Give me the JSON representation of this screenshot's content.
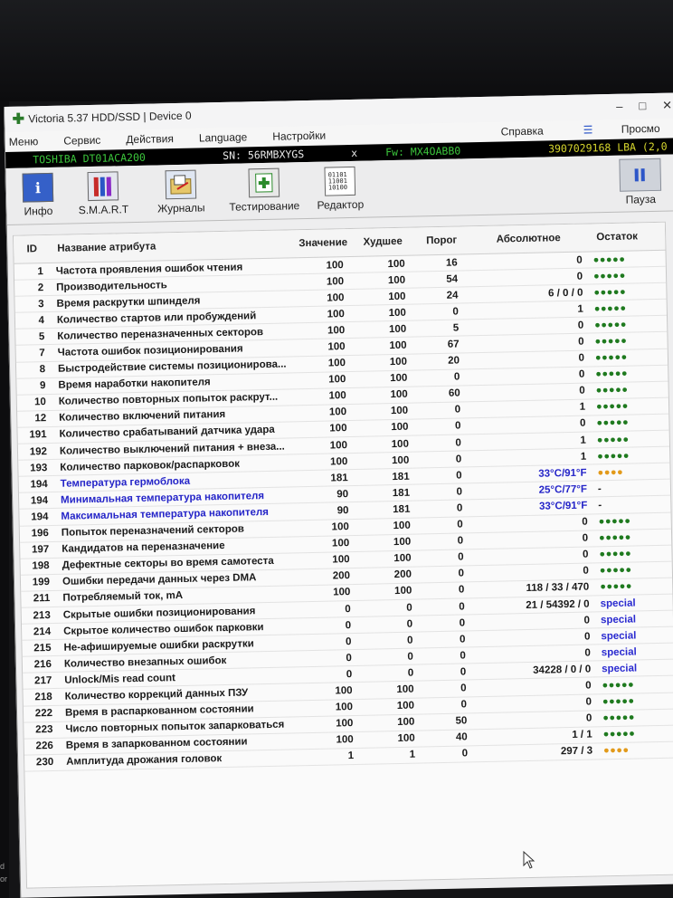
{
  "window": {
    "title": "Victoria 5.37 HDD/SSD | Device 0"
  },
  "menu": [
    "Меню",
    "Сервис",
    "Действия",
    "Language",
    "Настройки"
  ],
  "menu_right": {
    "help": "Справка",
    "view": "Просмо"
  },
  "device": {
    "model": "TOSHIBA DT01ACA200",
    "serial": "SN: 56RMBXYGS",
    "sep": "x",
    "firmware": "Fw: MX4OABB0",
    "lba": "3907029168 LBA (2,0 T"
  },
  "toolbar": {
    "info": "Инфо",
    "smart": "S.M.A.R.T",
    "logs": "Журналы",
    "test": "Тестирование",
    "editor": "Редактор",
    "pause": "Пауза"
  },
  "icon_names": [
    "info-icon",
    "smart-icon",
    "logs-icon",
    "test-icon",
    "editor-icon",
    "pause-icon"
  ],
  "colors": {
    "status_green": "#3cc63c",
    "status_yellow": "#d7d72e",
    "temp_blue": "#2424c8",
    "dots_green": "#1f7a1f",
    "dots_orange": "#e29a1a"
  },
  "table": {
    "headers": [
      "ID",
      "Название атрибута",
      "Значение",
      "Худшее",
      "Порог",
      "Абсолютное",
      "Остаток"
    ],
    "rows": [
      {
        "id": "1",
        "name": "Частота проявления ошибок чтения",
        "val": "100",
        "worst": "100",
        "thr": "16",
        "abs": "0",
        "rem": "●●●●●",
        "rem_type": "green"
      },
      {
        "id": "2",
        "name": "Производительность",
        "val": "100",
        "worst": "100",
        "thr": "54",
        "abs": "0",
        "rem": "●●●●●",
        "rem_type": "green"
      },
      {
        "id": "3",
        "name": "Время раскрутки шпинделя",
        "val": "100",
        "worst": "100",
        "thr": "24",
        "abs": "6 / 0 / 0",
        "rem": "●●●●●",
        "rem_type": "green"
      },
      {
        "id": "4",
        "name": "Количество стартов или пробуждений",
        "val": "100",
        "worst": "100",
        "thr": "0",
        "abs": "1",
        "rem": "●●●●●",
        "rem_type": "green"
      },
      {
        "id": "5",
        "name": "Количество переназначенных секторов",
        "val": "100",
        "worst": "100",
        "thr": "5",
        "abs": "0",
        "rem": "●●●●●",
        "rem_type": "green"
      },
      {
        "id": "7",
        "name": "Частота ошибок позиционирования",
        "val": "100",
        "worst": "100",
        "thr": "67",
        "abs": "0",
        "rem": "●●●●●",
        "rem_type": "green"
      },
      {
        "id": "8",
        "name": "Быстродействие системы позиционирова...",
        "val": "100",
        "worst": "100",
        "thr": "20",
        "abs": "0",
        "rem": "●●●●●",
        "rem_type": "green"
      },
      {
        "id": "9",
        "name": "Время наработки накопителя",
        "val": "100",
        "worst": "100",
        "thr": "0",
        "abs": "0",
        "rem": "●●●●●",
        "rem_type": "green"
      },
      {
        "id": "10",
        "name": "Количество повторных попыток раскрут...",
        "val": "100",
        "worst": "100",
        "thr": "60",
        "abs": "0",
        "rem": "●●●●●",
        "rem_type": "green"
      },
      {
        "id": "12",
        "name": "Количество включений питания",
        "val": "100",
        "worst": "100",
        "thr": "0",
        "abs": "1",
        "rem": "●●●●●",
        "rem_type": "green"
      },
      {
        "id": "191",
        "name": "Количество срабатываний датчика удара",
        "val": "100",
        "worst": "100",
        "thr": "0",
        "abs": "0",
        "rem": "●●●●●",
        "rem_type": "green"
      },
      {
        "id": "192",
        "name": "Количество выключений питания + внеза...",
        "val": "100",
        "worst": "100",
        "thr": "0",
        "abs": "1",
        "rem": "●●●●●",
        "rem_type": "green"
      },
      {
        "id": "193",
        "name": "Количество парковок/распарковок",
        "val": "100",
        "worst": "100",
        "thr": "0",
        "abs": "1",
        "rem": "●●●●●",
        "rem_type": "green"
      },
      {
        "id": "194",
        "name": "Температура гермоблока",
        "val": "181",
        "worst": "181",
        "thr": "0",
        "abs": "33°C/91°F",
        "rem": "●●●●",
        "rem_type": "orange",
        "blue": true
      },
      {
        "id": "194",
        "name": "Минимальная температура накопителя",
        "val": "90",
        "worst": "181",
        "thr": "0",
        "abs": "25°C/77°F",
        "rem": "-",
        "rem_type": "plain",
        "blue": true
      },
      {
        "id": "194",
        "name": "Максимальная температура накопителя",
        "val": "90",
        "worst": "181",
        "thr": "0",
        "abs": "33°C/91°F",
        "rem": "-",
        "rem_type": "plain",
        "blue": true
      },
      {
        "id": "196",
        "name": "Попыток переназначений секторов",
        "val": "100",
        "worst": "100",
        "thr": "0",
        "abs": "0",
        "rem": "●●●●●",
        "rem_type": "green"
      },
      {
        "id": "197",
        "name": "Кандидатов на переназначение",
        "val": "100",
        "worst": "100",
        "thr": "0",
        "abs": "0",
        "rem": "●●●●●",
        "rem_type": "green"
      },
      {
        "id": "198",
        "name": "Дефектные секторы во время самотеста",
        "val": "100",
        "worst": "100",
        "thr": "0",
        "abs": "0",
        "rem": "●●●●●",
        "rem_type": "green"
      },
      {
        "id": "199",
        "name": "Ошибки передачи данных через DMA",
        "val": "200",
        "worst": "200",
        "thr": "0",
        "abs": "0",
        "rem": "●●●●●",
        "rem_type": "green"
      },
      {
        "id": "211",
        "name": "Потребляемый ток, mA",
        "val": "100",
        "worst": "100",
        "thr": "0",
        "abs": "118 / 33 / 470",
        "rem": "●●●●●",
        "rem_type": "green"
      },
      {
        "id": "213",
        "name": "Скрытые ошибки позиционирования",
        "val": "0",
        "worst": "0",
        "thr": "0",
        "abs": "21 / 54392 / 0",
        "rem": "special",
        "rem_type": "special"
      },
      {
        "id": "214",
        "name": "Скрытое количество ошибок парковки",
        "val": "0",
        "worst": "0",
        "thr": "0",
        "abs": "0",
        "rem": "special",
        "rem_type": "special"
      },
      {
        "id": "215",
        "name": "Не-афишируемые ошибки раскрутки",
        "val": "0",
        "worst": "0",
        "thr": "0",
        "abs": "0",
        "rem": "special",
        "rem_type": "special"
      },
      {
        "id": "216",
        "name": "Количество внезапных ошибок",
        "val": "0",
        "worst": "0",
        "thr": "0",
        "abs": "0",
        "rem": "special",
        "rem_type": "special"
      },
      {
        "id": "217",
        "name": "Unlock/Mis read count",
        "val": "0",
        "worst": "0",
        "thr": "0",
        "abs": "34228 / 0 / 0",
        "rem": "special",
        "rem_type": "special"
      },
      {
        "id": "218",
        "name": "Количество коррекций данных ПЗУ",
        "val": "100",
        "worst": "100",
        "thr": "0",
        "abs": "0",
        "rem": "●●●●●",
        "rem_type": "green"
      },
      {
        "id": "222",
        "name": "Время в распаркованном состоянии",
        "val": "100",
        "worst": "100",
        "thr": "0",
        "abs": "0",
        "rem": "●●●●●",
        "rem_type": "green"
      },
      {
        "id": "223",
        "name": "Число повторных попыток запарковаться",
        "val": "100",
        "worst": "100",
        "thr": "50",
        "abs": "0",
        "rem": "●●●●●",
        "rem_type": "green"
      },
      {
        "id": "226",
        "name": "Время в запаркованном состоянии",
        "val": "100",
        "worst": "100",
        "thr": "40",
        "abs": "1 / 1",
        "rem": "●●●●●",
        "rem_type": "green"
      },
      {
        "id": "230",
        "name": "Амплитуда дрожания головок",
        "val": "1",
        "worst": "1",
        "thr": "0",
        "abs": "297 / 3",
        "rem": "●●●●",
        "rem_type": "orange"
      }
    ]
  },
  "side_text": [
    "d",
    "or"
  ]
}
